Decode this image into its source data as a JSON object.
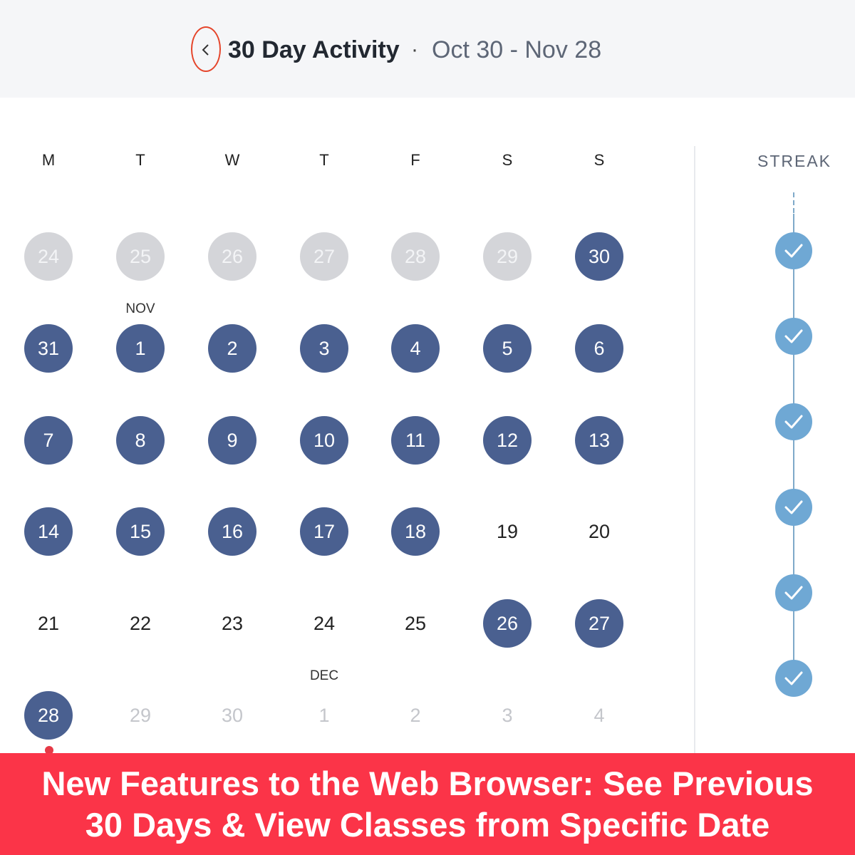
{
  "header": {
    "back_label": "Previous 30 days",
    "title": "30 Day Activity",
    "separator": "·",
    "range": "Oct 30 - Nov 28"
  },
  "weekdays": [
    "M",
    "T",
    "W",
    "T",
    "F",
    "S",
    "S"
  ],
  "month_labels": {
    "nov": "NOV",
    "dec": "DEC"
  },
  "calendar": {
    "rows": [
      [
        {
          "d": "24",
          "s": "past"
        },
        {
          "d": "25",
          "s": "past"
        },
        {
          "d": "26",
          "s": "past"
        },
        {
          "d": "27",
          "s": "past"
        },
        {
          "d": "28",
          "s": "past"
        },
        {
          "d": "29",
          "s": "past"
        },
        {
          "d": "30",
          "s": "active"
        }
      ],
      [
        {
          "d": "31",
          "s": "active"
        },
        {
          "d": "1",
          "s": "active"
        },
        {
          "d": "2",
          "s": "active"
        },
        {
          "d": "3",
          "s": "active"
        },
        {
          "d": "4",
          "s": "active"
        },
        {
          "d": "5",
          "s": "active"
        },
        {
          "d": "6",
          "s": "active"
        }
      ],
      [
        {
          "d": "7",
          "s": "active"
        },
        {
          "d": "8",
          "s": "active"
        },
        {
          "d": "9",
          "s": "active"
        },
        {
          "d": "10",
          "s": "active"
        },
        {
          "d": "11",
          "s": "active"
        },
        {
          "d": "12",
          "s": "active"
        },
        {
          "d": "13",
          "s": "active"
        }
      ],
      [
        {
          "d": "14",
          "s": "active"
        },
        {
          "d": "15",
          "s": "active"
        },
        {
          "d": "16",
          "s": "active"
        },
        {
          "d": "17",
          "s": "active"
        },
        {
          "d": "18",
          "s": "active"
        },
        {
          "d": "19",
          "s": "plain"
        },
        {
          "d": "20",
          "s": "plain"
        }
      ],
      [
        {
          "d": "21",
          "s": "plain"
        },
        {
          "d": "22",
          "s": "plain"
        },
        {
          "d": "23",
          "s": "plain"
        },
        {
          "d": "24",
          "s": "plain"
        },
        {
          "d": "25",
          "s": "plain"
        },
        {
          "d": "26",
          "s": "active"
        },
        {
          "d": "27",
          "s": "active"
        }
      ],
      [
        {
          "d": "28",
          "s": "active"
        },
        {
          "d": "29",
          "s": "future"
        },
        {
          "d": "30",
          "s": "future"
        },
        {
          "d": "1",
          "s": "future"
        },
        {
          "d": "2",
          "s": "future"
        },
        {
          "d": "3",
          "s": "future"
        },
        {
          "d": "4",
          "s": "future"
        }
      ]
    ],
    "today": "28"
  },
  "streak": {
    "label": "STREAK",
    "weeks_completed": 6,
    "icon": "check-icon"
  },
  "colors": {
    "active": "#4a6090",
    "past": "#d4d5d9",
    "streak": "#6fa8d4",
    "banner": "#fb3448",
    "highlight_ring": "#e5452b"
  },
  "banner": {
    "line1": "New Features to the Web Browser: See Previous",
    "line2": "30 Days & View Classes from Specific Date"
  }
}
